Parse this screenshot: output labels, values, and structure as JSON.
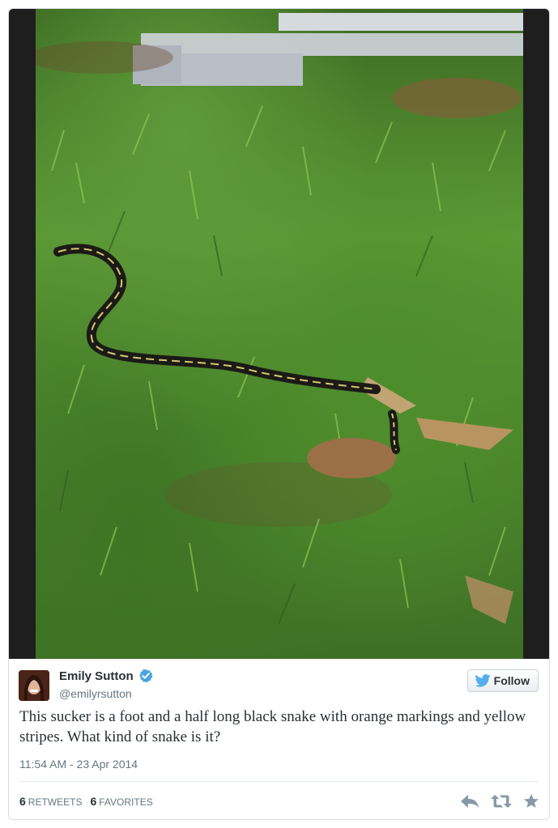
{
  "user": {
    "name": "Emily Sutton",
    "handle": "@emilyrsutton"
  },
  "follow_label": "Follow",
  "tweet": {
    "text": "This sucker is a foot and a half long black snake with orange markings and yellow stripes. What kind of snake is it?",
    "timestamp": "11:54 AM - 23 Apr 2014"
  },
  "stats": {
    "retweets_count": "6",
    "retweets_label": "RETWEETS",
    "favorites_count": "6",
    "favorites_label": "FAVORITES"
  },
  "icons": {
    "verified": "verified-badge-icon",
    "follow": "twitter-bird-icon",
    "reply": "reply-icon",
    "retweet": "retweet-icon",
    "favorite": "star-icon"
  },
  "colors": {
    "verified": "#4aa3df",
    "twitter_blue": "#55acee",
    "text": "#292f33",
    "muted": "#66757f"
  }
}
